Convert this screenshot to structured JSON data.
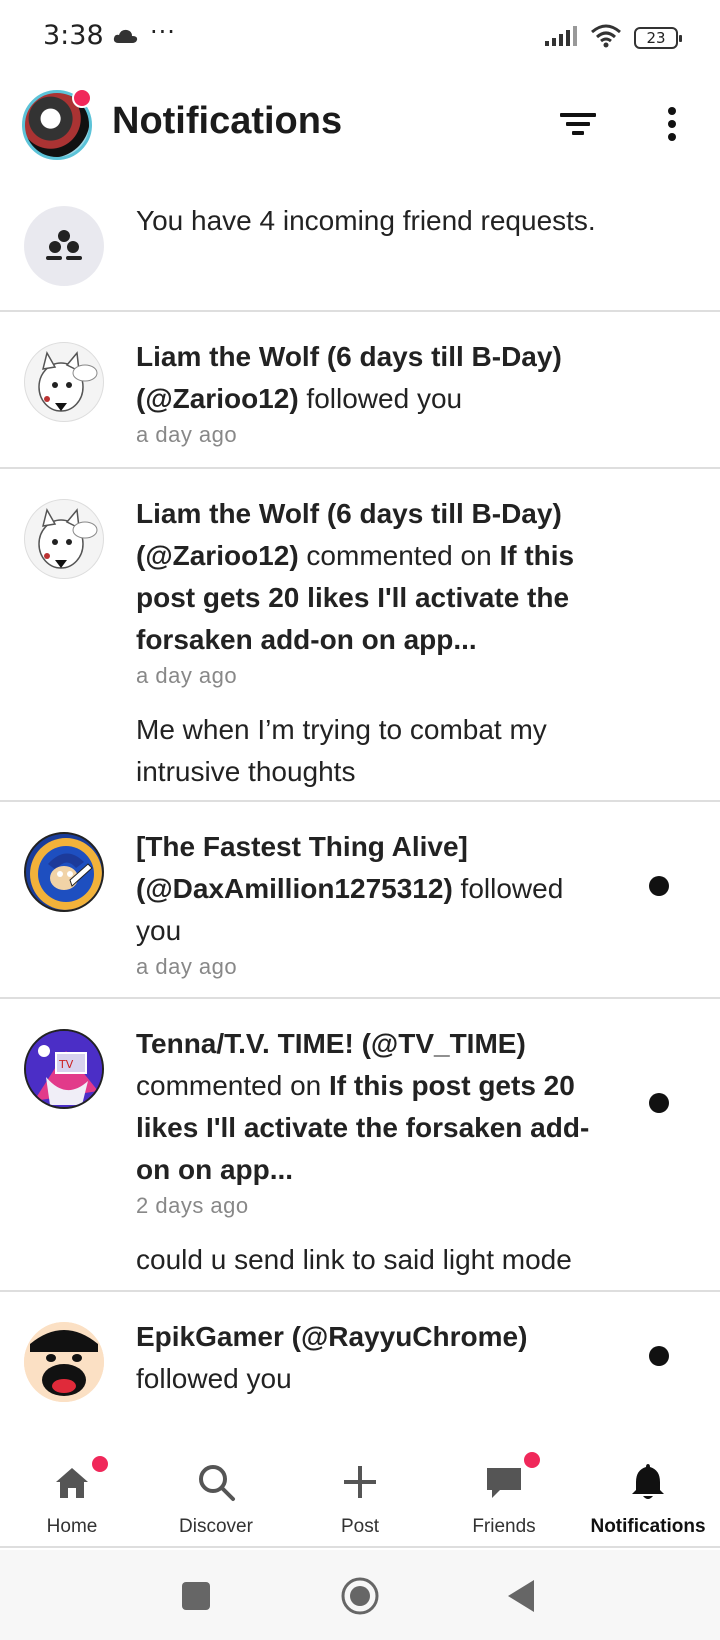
{
  "status_bar": {
    "time": "3:38",
    "dots": "···",
    "battery": "23",
    "icons": [
      "cloud-icon",
      "signal-icon",
      "wifi-icon",
      "battery-icon"
    ]
  },
  "header": {
    "title": "Notifications",
    "icons": [
      "filter-icon",
      "more-vertical-icon"
    ],
    "badge_color": "#f0285a"
  },
  "friend_requests": {
    "text": "You have 4 incoming friend requests.",
    "icon": "people-icon"
  },
  "notifications": [
    {
      "user": "Liam the Wolf (6 days till B-Day) (@Zarioo12)",
      "action": " followed you",
      "time": "a day ago",
      "unread": false
    },
    {
      "user": "Liam the Wolf (6 days till B-Day) (@Zarioo12)",
      "action": " commented on ",
      "target": "If this post gets 20 likes I'll activate the forsaken add-on on app...",
      "time": "a day ago",
      "comment": "Me when I’m trying to combat my intrusive thoughts",
      "unread": false
    },
    {
      "user": "[The Fastest Thing Alive] (@DaxAmillion1275312)",
      "action": " followed you",
      "time": "a day ago",
      "unread": true
    },
    {
      "user": "Tenna/T.V. TIME! (@TV_TIME)",
      "action": " commented on ",
      "target": "If this post gets 20 likes I'll activate the forsaken add-on on app...",
      "time": "2 days ago",
      "comment": "could u send link to said light mode",
      "unread": true
    },
    {
      "user": "EpikGamer (@RayyuChrome)",
      "action": " followed you",
      "unread": true
    }
  ],
  "bottom_nav": {
    "items": [
      {
        "label": "Home",
        "icon": "home-icon",
        "badge": true,
        "active": false
      },
      {
        "label": "Discover",
        "icon": "search-icon",
        "badge": false,
        "active": false
      },
      {
        "label": "Post",
        "icon": "plus-icon",
        "badge": false,
        "active": false
      },
      {
        "label": "Friends",
        "icon": "chat-icon",
        "badge": true,
        "active": false
      },
      {
        "label": "Notifications",
        "icon": "bell-icon",
        "badge": false,
        "active": true
      }
    ]
  },
  "system_nav": {
    "icons": [
      "recents-icon",
      "home-circle-icon",
      "back-icon"
    ]
  }
}
